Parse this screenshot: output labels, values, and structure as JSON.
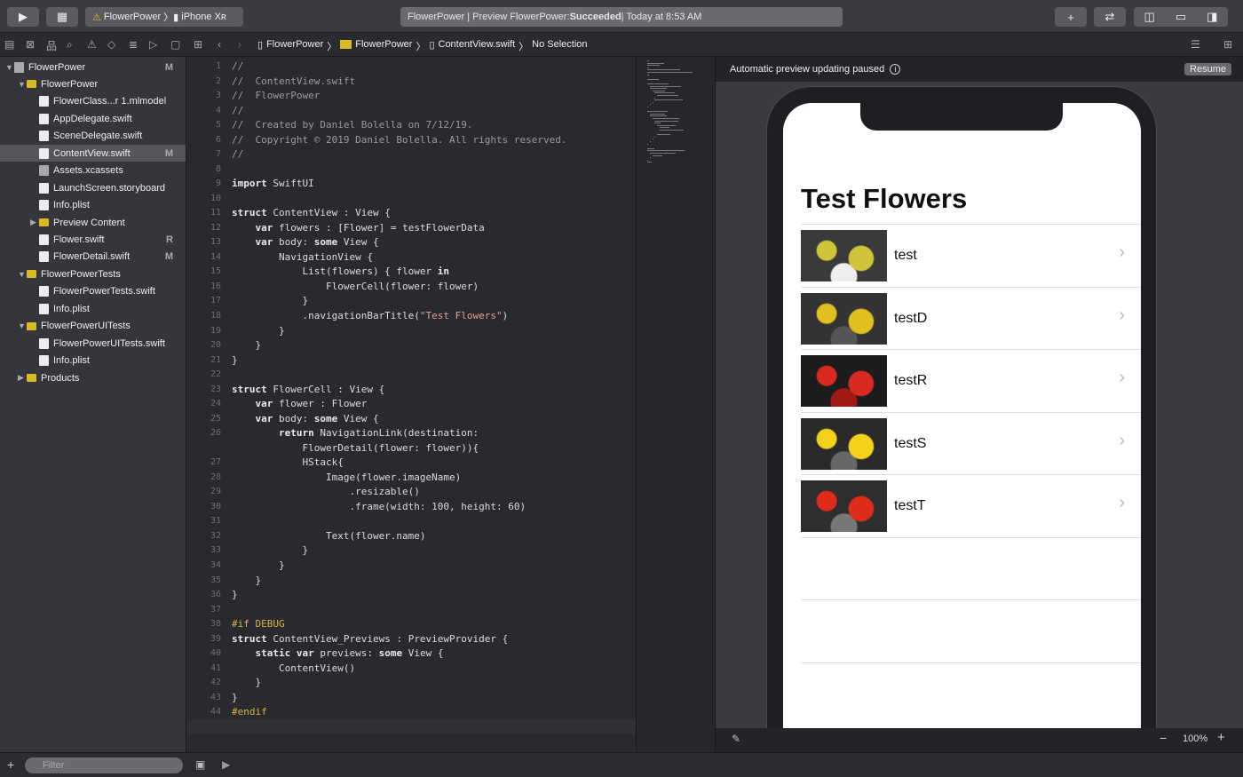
{
  "toolbar": {
    "scheme": "FlowerPower",
    "device": "iPhone Xʀ",
    "status_prefix": "FlowerPower | Preview FlowerPower: ",
    "status_result": "Succeeded",
    "status_time": " | Today at 8:53 AM"
  },
  "breadcrumb": [
    "FlowerPower",
    "FlowerPower",
    "ContentView.swift",
    "No Selection"
  ],
  "sidebar": {
    "items": [
      {
        "label": "FlowerPower",
        "depth": 0,
        "type": "project",
        "expanded": true,
        "badge": "M"
      },
      {
        "label": "FlowerPower",
        "depth": 1,
        "type": "folder",
        "expanded": true,
        "badge": ""
      },
      {
        "label": "FlowerClass...r 1.mlmodel",
        "depth": 2,
        "type": "file",
        "badge": ""
      },
      {
        "label": "AppDelegate.swift",
        "depth": 2,
        "type": "file",
        "badge": ""
      },
      {
        "label": "SceneDelegate.swift",
        "depth": 2,
        "type": "file",
        "badge": ""
      },
      {
        "label": "ContentView.swift",
        "depth": 2,
        "type": "file",
        "badge": "M",
        "selected": true
      },
      {
        "label": "Assets.xcassets",
        "depth": 2,
        "type": "gray",
        "badge": ""
      },
      {
        "label": "LaunchScreen.storyboard",
        "depth": 2,
        "type": "file",
        "badge": ""
      },
      {
        "label": "Info.plist",
        "depth": 2,
        "type": "file",
        "badge": ""
      },
      {
        "label": "Preview Content",
        "depth": 2,
        "type": "folder",
        "expanded": false,
        "badge": ""
      },
      {
        "label": "Flower.swift",
        "depth": 2,
        "type": "file",
        "badge": "R"
      },
      {
        "label": "FlowerDetail.swift",
        "depth": 2,
        "type": "file",
        "badge": "M"
      },
      {
        "label": "FlowerPowerTests",
        "depth": 1,
        "type": "folder",
        "expanded": true,
        "badge": ""
      },
      {
        "label": "FlowerPowerTests.swift",
        "depth": 2,
        "type": "file",
        "badge": ""
      },
      {
        "label": "Info.plist",
        "depth": 2,
        "type": "file",
        "badge": ""
      },
      {
        "label": "FlowerPowerUITests",
        "depth": 1,
        "type": "folder",
        "expanded": true,
        "badge": ""
      },
      {
        "label": "FlowerPowerUITests.swift",
        "depth": 2,
        "type": "file",
        "badge": ""
      },
      {
        "label": "Info.plist",
        "depth": 2,
        "type": "file",
        "badge": ""
      },
      {
        "label": "Products",
        "depth": 1,
        "type": "folder",
        "expanded": false,
        "badge": ""
      }
    ],
    "filter_placeholder": "Filter"
  },
  "code": [
    {
      "n": "1",
      "t": "//"
    },
    {
      "n": "2",
      "t": "//  ContentView.swift"
    },
    {
      "n": "3",
      "t": "//  FlowerPower"
    },
    {
      "n": "4",
      "t": "//"
    },
    {
      "n": "5",
      "t": "//  Created by Daniel Bolella on 7/12/19."
    },
    {
      "n": "6",
      "t": "//  Copyright © 2019 Daniel Bolella. All rights reserved."
    },
    {
      "n": "7",
      "t": "//"
    },
    {
      "n": "8",
      "t": ""
    },
    {
      "n": "9",
      "t": "import SwiftUI"
    },
    {
      "n": "10",
      "t": ""
    },
    {
      "n": "11",
      "t": "struct ContentView : View {"
    },
    {
      "n": "12",
      "t": "    var flowers : [Flower] = testFlowerData"
    },
    {
      "n": "13",
      "t": "    var body: some View {"
    },
    {
      "n": "14",
      "t": "        NavigationView {"
    },
    {
      "n": "15",
      "t": "            List(flowers) { flower in"
    },
    {
      "n": "16",
      "t": "                FlowerCell(flower: flower)"
    },
    {
      "n": "17",
      "t": "            }"
    },
    {
      "n": "18",
      "t": "            .navigationBarTitle(\"Test Flowers\")"
    },
    {
      "n": "19",
      "t": "        }"
    },
    {
      "n": "20",
      "t": "    }"
    },
    {
      "n": "21",
      "t": "}"
    },
    {
      "n": "22",
      "t": ""
    },
    {
      "n": "23",
      "t": "struct FlowerCell : View {"
    },
    {
      "n": "24",
      "t": "    var flower : Flower"
    },
    {
      "n": "25",
      "t": "    var body: some View {"
    },
    {
      "n": "26",
      "t": "        return NavigationLink(destination:"
    },
    {
      "n": "",
      "t": "            FlowerDetail(flower: flower)){"
    },
    {
      "n": "27",
      "t": "            HStack{"
    },
    {
      "n": "28",
      "t": "                Image(flower.imageName)"
    },
    {
      "n": "29",
      "t": "                    .resizable()"
    },
    {
      "n": "30",
      "t": "                    .frame(width: 100, height: 60)"
    },
    {
      "n": "31",
      "t": ""
    },
    {
      "n": "32",
      "t": "                Text(flower.name)"
    },
    {
      "n": "33",
      "t": "            }"
    },
    {
      "n": "34",
      "t": "        }"
    },
    {
      "n": "35",
      "t": "    }"
    },
    {
      "n": "36",
      "t": "}"
    },
    {
      "n": "37",
      "t": ""
    },
    {
      "n": "38",
      "t": "#if DEBUG"
    },
    {
      "n": "39",
      "t": "struct ContentView_Previews : PreviewProvider {"
    },
    {
      "n": "40",
      "t": "    static var previews: some View {"
    },
    {
      "n": "41",
      "t": "        ContentView()"
    },
    {
      "n": "42",
      "t": "    }"
    },
    {
      "n": "43",
      "t": "}"
    },
    {
      "n": "44",
      "t": "#endif"
    },
    {
      "n": "45",
      "t": ""
    }
  ],
  "preview": {
    "banner": "Automatic preview updating paused",
    "resume": "Resume",
    "zoom": "100%",
    "title": "Test Flowers",
    "rows": [
      {
        "label": "test",
        "colors": [
          "#3a3a3a",
          "#cfc43a",
          "#eee"
        ]
      },
      {
        "label": "testD",
        "colors": [
          "#333",
          "#e0c020",
          "#555"
        ]
      },
      {
        "label": "testR",
        "colors": [
          "#1c1c1c",
          "#d82a20",
          "#a01812"
        ]
      },
      {
        "label": "testS",
        "colors": [
          "#2a2a2a",
          "#f2d21a",
          "#666"
        ]
      },
      {
        "label": "testT",
        "colors": [
          "#2e2e2e",
          "#e02a1a",
          "#777"
        ]
      }
    ]
  },
  "colors": {
    "folder": "#d9b928",
    "background": "#292a30"
  }
}
